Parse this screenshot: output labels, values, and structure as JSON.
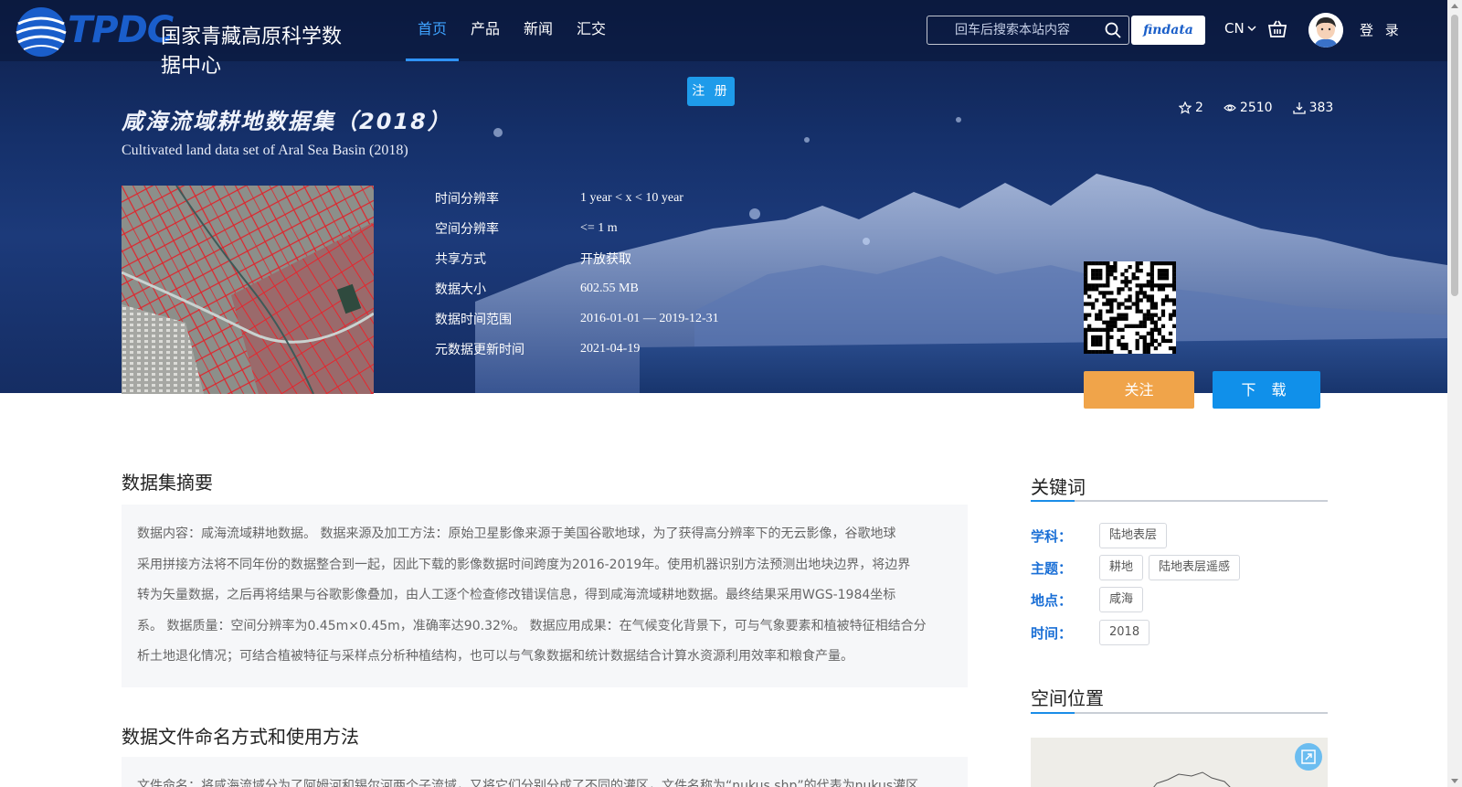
{
  "nav": {
    "logo_text": "TPDC",
    "logo_cn": "国家青藏高原科学数据中心",
    "menu": [
      "首页",
      "产品",
      "新闻",
      "汇交"
    ],
    "search_placeholder": "回车后搜索本站内容",
    "findata_label": "findata",
    "lang_label": "CN",
    "login_label": "登 录"
  },
  "register_label": "注 册",
  "dataset": {
    "title": "咸海流域耕地数据集（2018）",
    "subtitle": "Cultivated land data set of Aral Sea Basin (2018)",
    "stats": {
      "stars": "2",
      "views": "2510",
      "downloads": "383"
    },
    "meta": [
      {
        "key": "时间分辨率",
        "value": "1 year < x < 10 year"
      },
      {
        "key": "空间分辨率",
        "value": "<= 1 m"
      },
      {
        "key": "共享方式",
        "value": "开放获取"
      },
      {
        "key": "数据大小",
        "value": "602.55 MB"
      },
      {
        "key": "数据时间范围",
        "value": "2016-01-01 — 2019-12-31"
      },
      {
        "key": "元数据更新时间",
        "value": "2021-04-19"
      }
    ],
    "follow_label": "关注",
    "download_label": "下 载"
  },
  "abstract": {
    "title": "数据集摘要",
    "lines": [
      "数据内容：咸海流域耕地数据。 数据来源及加工方法：原始卫星影像来源于美国谷歌地球，为了获得高分辨率下的无云影像，谷歌地球",
      "采用拼接方法将不同年份的数据整合到一起，因此下载的影像数据时间跨度为2016-2019年。使用机器识别方法预测出地块边界，将边界",
      "转为矢量数据，之后再将结果与谷歌影像叠加，由人工逐个检查修改错误信息，得到咸海流域耕地数据。最终结果采用WGS-1984坐标",
      "系。 数据质量：空间分辨率为0.45m×0.45m，准确率达90.32%。 数据应用成果：在气候变化背景下，可与气象要素和植被特征相结合分",
      "析土地退化情况；可结合植被特征与采样点分析种植结构，也可以与气象数据和统计数据结合计算水资源利用效率和粮食产量。"
    ]
  },
  "naming": {
    "title": "数据文件命名方式和使用方法",
    "text": "文件命名：将咸海流域分为了阿姆河和锡尔河两个子流域，又将它们分别分成了不同的灌区，文件名称为“nukus.shp”的代表为nukus灌区"
  },
  "keywords": {
    "title": "关键词",
    "rows": [
      {
        "label": "学科：",
        "tags": [
          "陆地表层"
        ]
      },
      {
        "label": "主题：",
        "tags": [
          "耕地",
          "陆地表层遥感"
        ]
      },
      {
        "label": "地点：",
        "tags": [
          "咸海"
        ]
      },
      {
        "label": "时间：",
        "tags": [
          "2018"
        ]
      }
    ]
  },
  "location": {
    "title": "空间位置"
  },
  "colors": {
    "accent": "#1a8de8",
    "follow": "#f0a44a",
    "download": "#1090ea",
    "keyword_label": "#1a6fd6"
  }
}
